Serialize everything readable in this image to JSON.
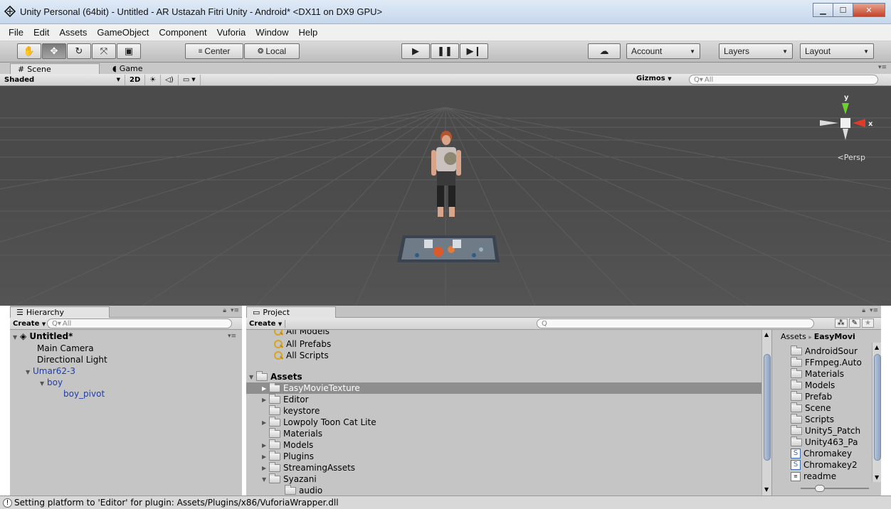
{
  "window": {
    "title": "Unity Personal (64bit) - Untitled - AR Ustazah Fitri Unity - Android* <DX11 on DX9 GPU>"
  },
  "menu": [
    "File",
    "Edit",
    "Assets",
    "GameObject",
    "Component",
    "Vuforia",
    "Window",
    "Help"
  ],
  "toolbar": {
    "pivot_label": "Center",
    "space_label": "Local",
    "account_label": "Account",
    "layers_label": "Layers",
    "layout_label": "Layout"
  },
  "scene_tabs": {
    "scene": "Scene",
    "game": "Game"
  },
  "scene_bar": {
    "shading": "Shaded",
    "mode_2d": "2D",
    "gizmos": "Gizmos",
    "search_placeholder": "All"
  },
  "gizmo": {
    "y_axis": "y",
    "x_axis": "x",
    "projection": "Persp"
  },
  "hierarchy": {
    "tab": "Hierarchy",
    "create": "Create",
    "search_placeholder": "All",
    "scene_name": "Untitled*",
    "items": [
      "Main Camera",
      "Directional Light",
      "Umar62-3",
      "boy",
      "boy_pivot"
    ]
  },
  "project": {
    "tab": "Project",
    "create": "Create",
    "favorites": [
      "All Models",
      "All Prefabs",
      "All Scripts"
    ],
    "root": "Assets",
    "folders": [
      "EasyMovieTexture",
      "Editor",
      "keystore",
      "Lowpoly Toon Cat Lite",
      "Materials",
      "Models",
      "Plugins",
      "StreamingAssets",
      "Syazani",
      "audio"
    ],
    "breadcrumb_root": "Assets",
    "breadcrumb_current": "EasyMovi",
    "contents": [
      "AndroidSour",
      "FFmpeg.Auto",
      "Materials",
      "Models",
      "Prefab",
      "Scene",
      "Scripts",
      "Unity5_Patch",
      "Unity463_Pa",
      "Chromakey",
      "Chromakey2",
      "readme"
    ]
  },
  "status": {
    "message": "Setting platform to 'Editor' for plugin: Assets/Plugins/x86/VuforiaWrapper.dll"
  },
  "colors": {
    "viewport_bg": "#4b4b4b",
    "panel_bg": "#c5c5c5",
    "selection": "#8e8e8e",
    "hierarchy_blue": "#1e3fa8",
    "axis_y": "#6fcf2f",
    "axis_x": "#e03a2a"
  }
}
